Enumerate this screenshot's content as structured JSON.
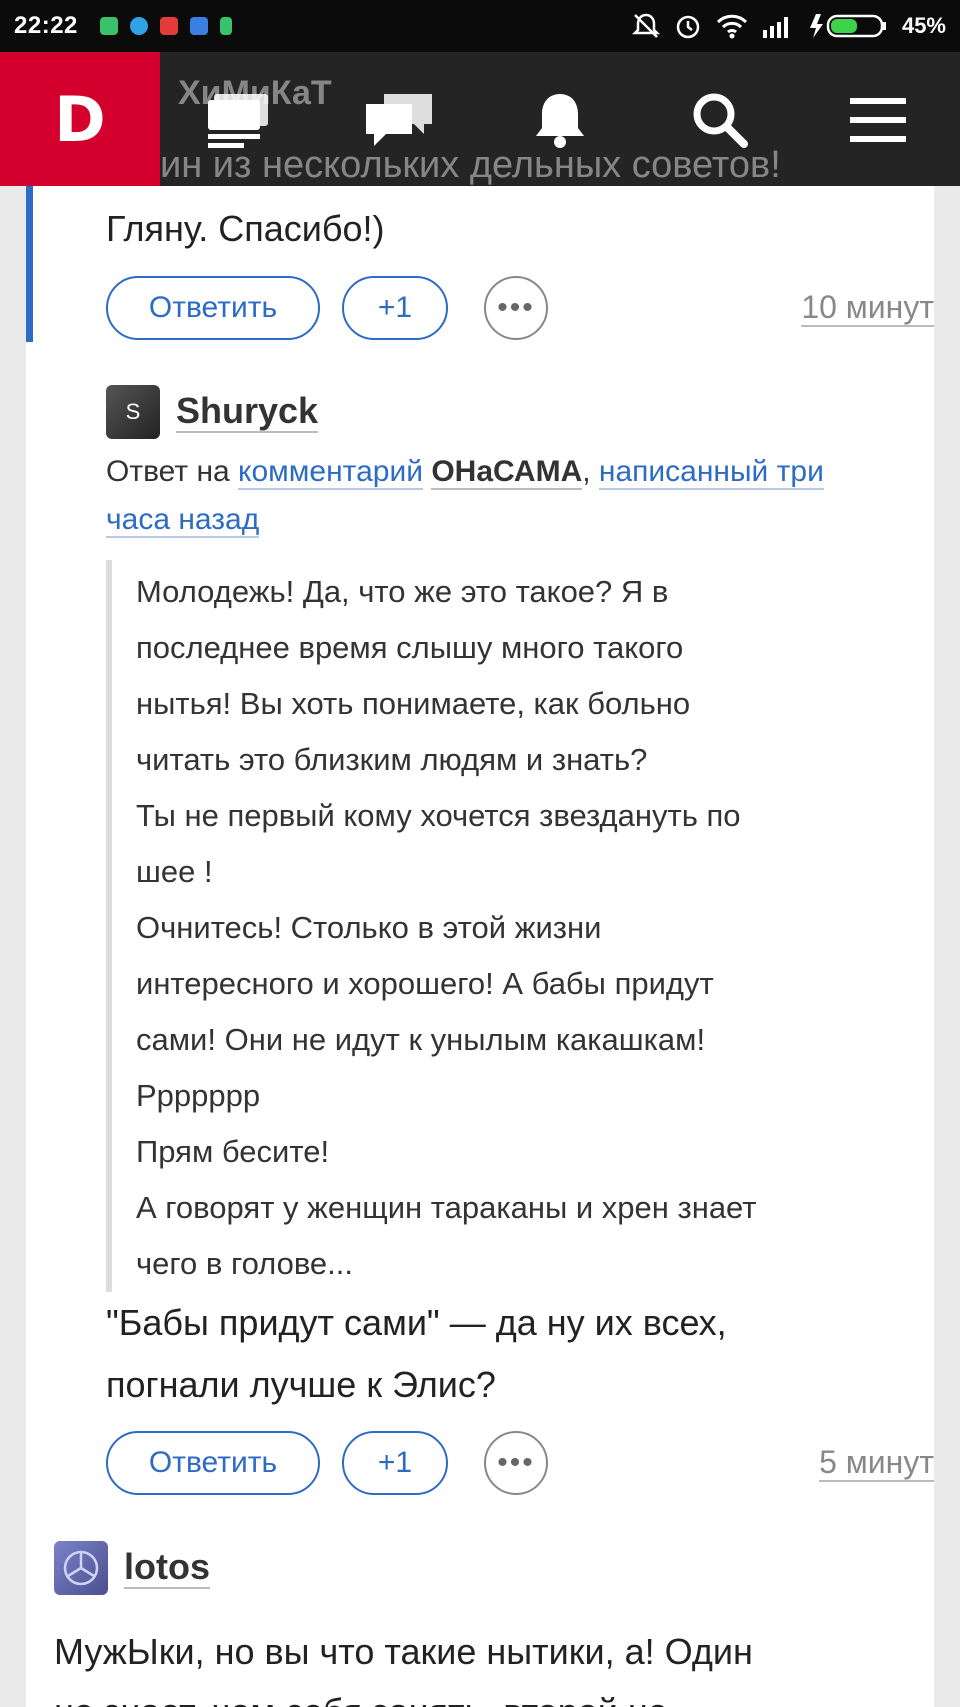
{
  "status_bar": {
    "time": "22:22",
    "battery": "45%",
    "notification_colors": [
      "#39c26b",
      "#2fa3e3",
      "#e33b3b",
      "#3b7fe3",
      "#39c26b"
    ]
  },
  "nav": {
    "logo": "D",
    "ghost_name": "ХиМиКаТ",
    "ghost_line": "ин из нескольких дельных советов!"
  },
  "comments": [
    {
      "text": "Гляну. Спасибо!)",
      "reply_label": "Ответить",
      "plus_label": "+1",
      "more_label": "•••",
      "time": "10 минут"
    },
    {
      "author": "Shuryck",
      "avatar_letter": "S",
      "meta_prefix": "Ответ на ",
      "meta_link": "комментарий",
      "meta_user": "ОНаСАМА",
      "meta_comma": ", ",
      "meta_written": "написанный три часа назад",
      "quote_lines": [
        "Молодежь! Да, что же это такое? Я в",
        "последнее время слышу много такого",
        "нытья! Вы хоть понимаете, как больно",
        "читать это близким людям и знать?",
        "Ты не первый кому хочется звездануть по",
        "шее !",
        "Очнитесь! Столько в этой жизни",
        "интересного и хорошего! А бабы придут",
        "сами! Они не идут к унылым какашкам!",
        "Ррррррр",
        "Прям бесите!",
        "А говорят у женщин тараканы и хрен знает",
        "чего в голове..."
      ],
      "text_line_1": "\"Бабы придут сами\" — да ну их всех,",
      "text_line_2": "погнали лучше к Элис?",
      "reply_label": "Ответить",
      "plus_label": "+1",
      "more_label": "•••",
      "time": "5 минут"
    },
    {
      "author": "lotos",
      "text_line_1": "МужЫки, но вы что такие нытики, а! Один",
      "text_line_2": "не знает, чем себя занять, второй не"
    }
  ]
}
